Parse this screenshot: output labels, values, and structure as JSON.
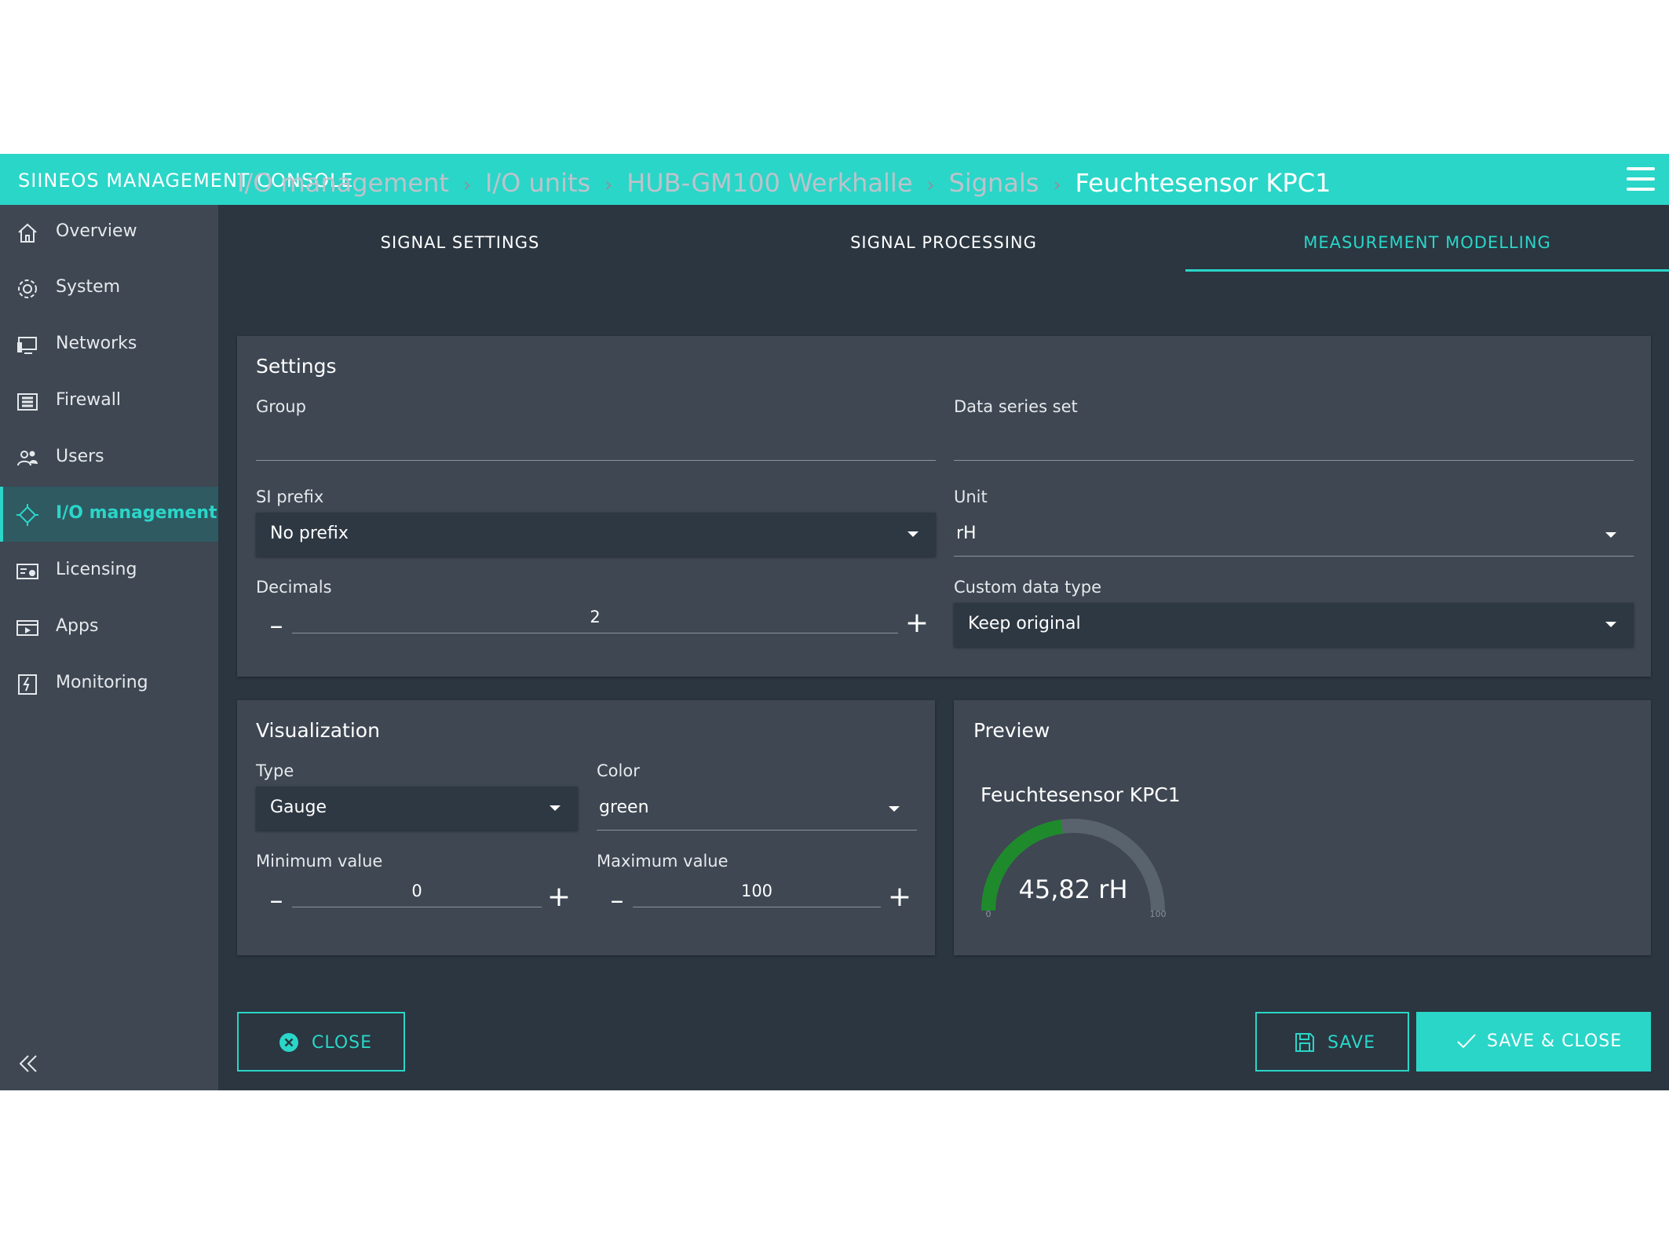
{
  "app": {
    "title": "SIINEOS MANAGEMENT CONSOLE"
  },
  "colors": {
    "accent": "#2ad6c8",
    "gauge_green": "#1f8a2c"
  },
  "sidebar": {
    "items": [
      {
        "label": "Overview",
        "icon": "home-icon"
      },
      {
        "label": "System",
        "icon": "gear-icon"
      },
      {
        "label": "Networks",
        "icon": "monitor-icon"
      },
      {
        "label": "Firewall",
        "icon": "firewall-icon"
      },
      {
        "label": "Users",
        "icon": "users-icon"
      },
      {
        "label": "I/O management",
        "icon": "io-icon",
        "active": true
      },
      {
        "label": "Licensing",
        "icon": "license-icon"
      },
      {
        "label": "Apps",
        "icon": "apps-icon"
      },
      {
        "label": "Monitoring",
        "icon": "monitoring-icon"
      }
    ]
  },
  "breadcrumb": [
    "I/O management",
    "I/O units",
    "HUB-GM100 Werkhalle",
    "Signals",
    "Feuchtesensor KPC1"
  ],
  "tabs": [
    {
      "label": "SIGNAL SETTINGS"
    },
    {
      "label": "SIGNAL PROCESSING"
    },
    {
      "label": "MEASUREMENT MODELLING",
      "active": true
    }
  ],
  "settings": {
    "title": "Settings",
    "group": {
      "label": "Group",
      "value": ""
    },
    "data_series_set": {
      "label": "Data series set",
      "value": ""
    },
    "si_prefix": {
      "label": "SI prefix",
      "value": "No prefix"
    },
    "unit": {
      "label": "Unit",
      "value": "rH"
    },
    "decimals": {
      "label": "Decimals",
      "value": "2"
    },
    "custom_data_type": {
      "label": "Custom data type",
      "value": "Keep original"
    }
  },
  "visualization": {
    "title": "Visualization",
    "type": {
      "label": "Type",
      "value": "Gauge"
    },
    "color": {
      "label": "Color",
      "value": "green"
    },
    "min": {
      "label": "Minimum value",
      "value": "0"
    },
    "max": {
      "label": "Maximum value",
      "value": "100"
    }
  },
  "preview": {
    "title": "Preview",
    "gauge_title": "Feuchtesensor KPC1",
    "value_text": "45,82 rH",
    "value": 45.82,
    "min": 0,
    "max": 100,
    "min_label": "0",
    "max_label": "100"
  },
  "buttons": {
    "close": "CLOSE",
    "save": "SAVE",
    "save_close": "SAVE & CLOSE"
  },
  "stepper": {
    "minus": "–",
    "plus": "+"
  }
}
